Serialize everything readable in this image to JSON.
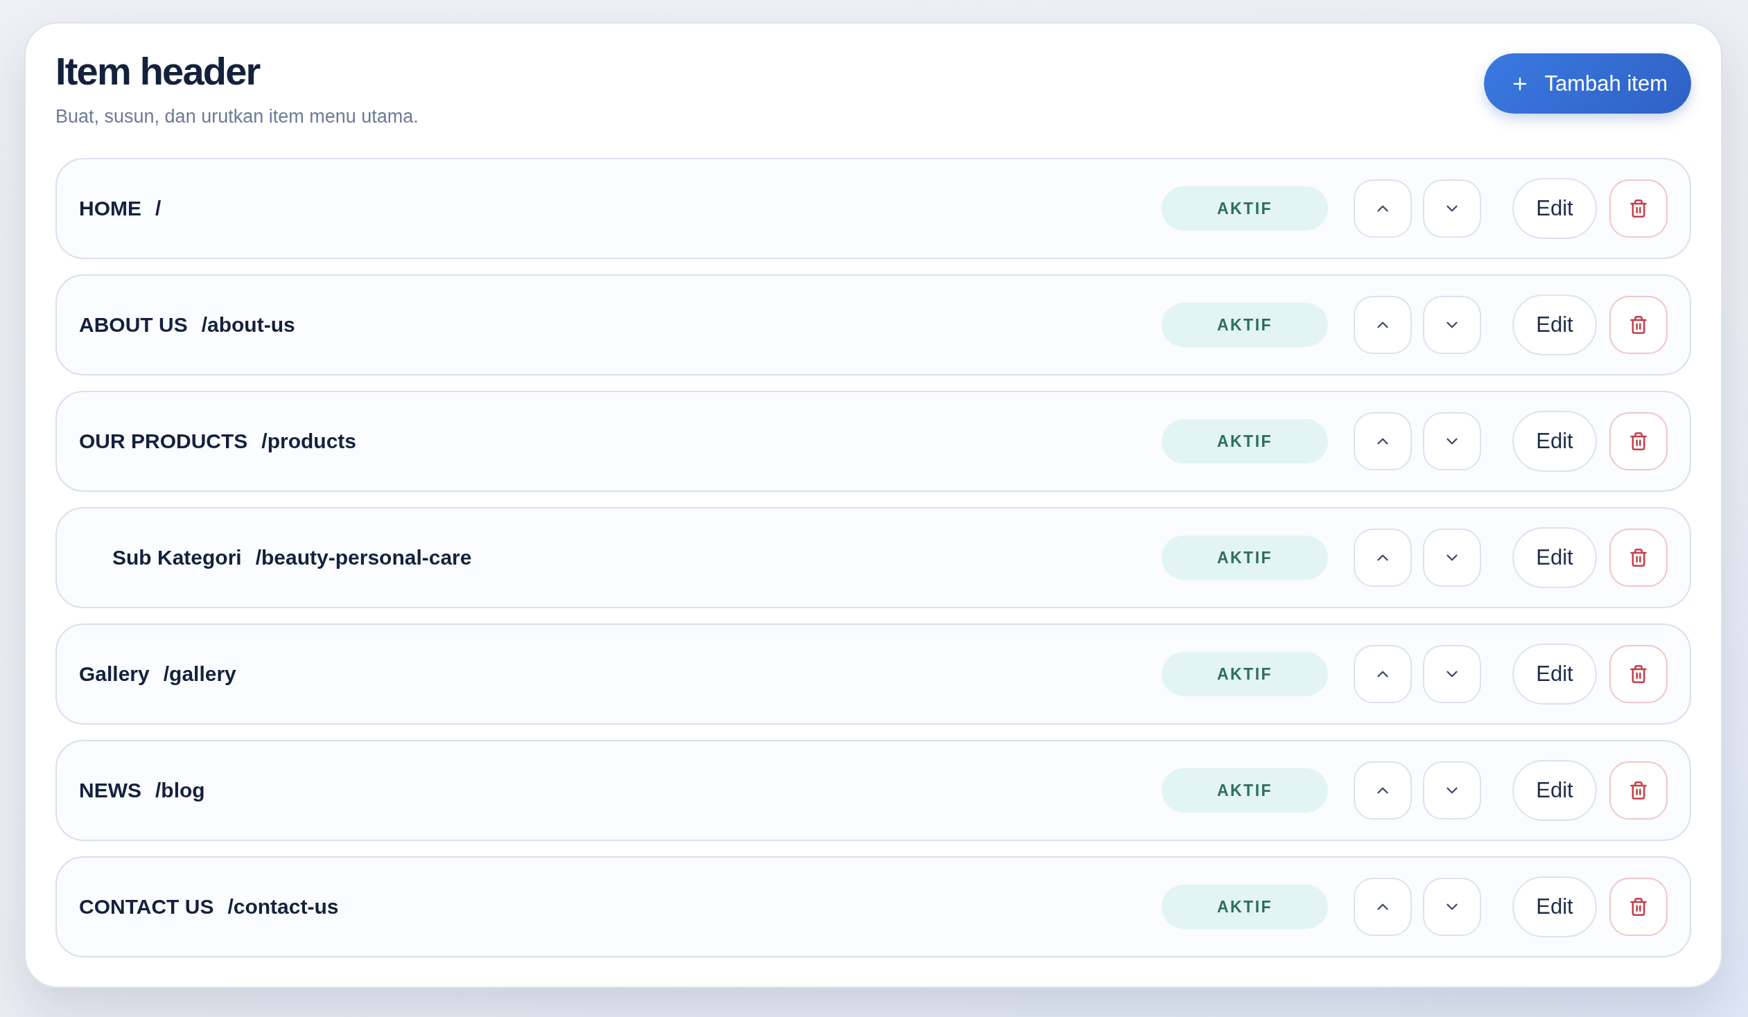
{
  "header": {
    "title": "Item header",
    "subtitle": "Buat, susun, dan urutkan item menu utama.",
    "add_button": "Tambah item"
  },
  "items": [
    {
      "name": "HOME",
      "path": "/",
      "status": "AKTIF",
      "edit": "Edit"
    },
    {
      "name": "ABOUT US",
      "path": "/about-us",
      "status": "AKTIF",
      "edit": "Edit"
    },
    {
      "name": "OUR PRODUCTS",
      "path": "/products",
      "status": "AKTIF",
      "edit": "Edit",
      "children": [
        {
          "name": "Sub Kategori",
          "path": "/beauty-personal-care",
          "status": "AKTIF",
          "edit": "Edit"
        }
      ]
    },
    {
      "name": "Gallery",
      "path": "/gallery",
      "status": "AKTIF",
      "edit": "Edit"
    },
    {
      "name": "NEWS",
      "path": "/blog",
      "status": "AKTIF",
      "edit": "Edit"
    },
    {
      "name": "CONTACT US",
      "path": "/contact-us",
      "status": "AKTIF",
      "edit": "Edit"
    }
  ]
}
